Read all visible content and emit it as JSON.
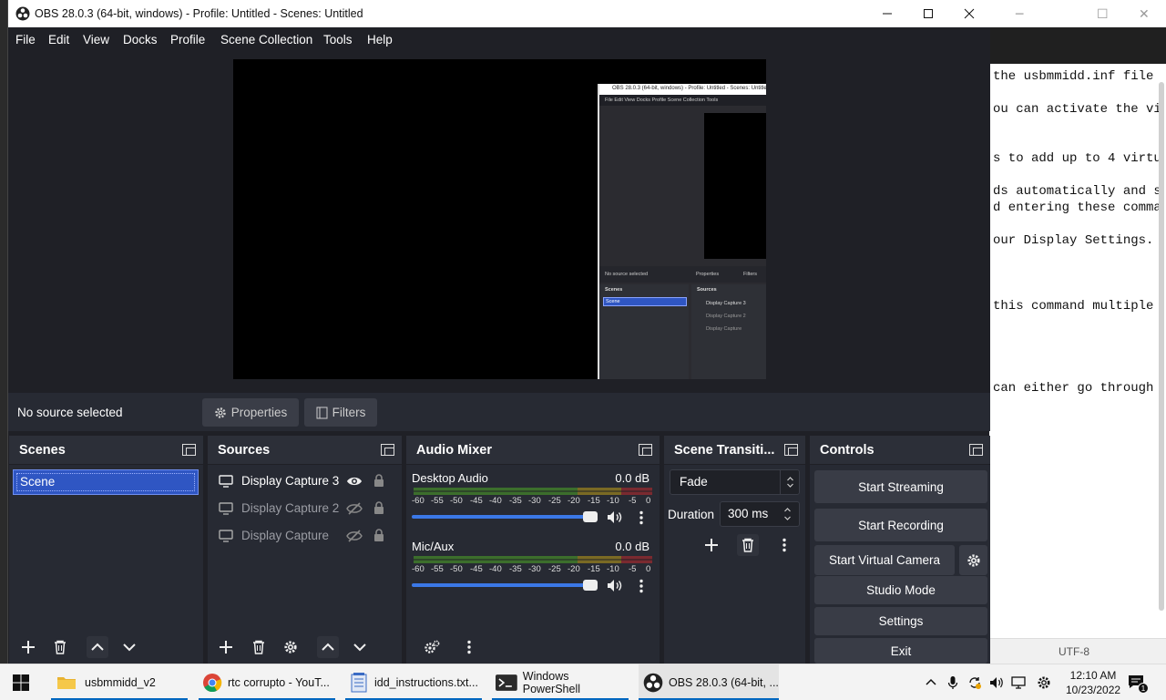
{
  "window": {
    "title": "OBS 28.0.3 (64-bit, windows) - Profile: Untitled - Scenes: Untitled"
  },
  "menu": [
    "File",
    "Edit",
    "View",
    "Docks",
    "Profile",
    "Scene Collection",
    "Tools",
    "Help"
  ],
  "nested_preview": {
    "title": "OBS 28.0.3 (64-bit, windows) - Profile: Untitled - Scenes: Untitled",
    "menu": "File   Edit   View   Docks   Profile   Scene Collection   Tools",
    "no_source": "No source selected",
    "properties": "Properties",
    "filters": "Filters",
    "scenes": "Scenes",
    "sources": "Sources",
    "scene": "Scene",
    "src1": "Display Capture 3",
    "src2": "Display Capture 2",
    "src3": "Display Capture"
  },
  "source_toolbar": {
    "no_source": "No source selected",
    "properties": "Properties",
    "filters": "Filters"
  },
  "scenes_dock": {
    "title": "Scenes",
    "items": [
      "Scene"
    ]
  },
  "sources_dock": {
    "title": "Sources",
    "items": [
      {
        "name": "Display Capture 3",
        "visible": true
      },
      {
        "name": "Display Capture 2",
        "visible": false
      },
      {
        "name": "Display Capture",
        "visible": false
      }
    ]
  },
  "audio_dock": {
    "title": "Audio Mixer",
    "channels": [
      {
        "name": "Desktop Audio",
        "db": "0.0 dB"
      },
      {
        "name": "Mic/Aux",
        "db": "0.0 dB"
      }
    ],
    "scale": [
      "-60",
      "-55",
      "-50",
      "-45",
      "-40",
      "-35",
      "-30",
      "-25",
      "-20",
      "-15",
      "-10",
      "-5",
      "0"
    ]
  },
  "transitions_dock": {
    "title": "Scene Transiti...",
    "transition": "Fade",
    "duration_label": "Duration",
    "duration_value": "300 ms"
  },
  "controls_dock": {
    "title": "Controls",
    "start_streaming": "Start Streaming",
    "start_recording": "Start Recording",
    "start_virtual_camera": "Start Virtual Camera",
    "studio_mode": "Studio Mode",
    "settings": "Settings",
    "exit": "Exit"
  },
  "notepad": {
    "lines": [
      " the usbmmidd.inf file",
      "ou can activate the vi",
      "s to add up to 4 virtu",
      "ds automatically and s",
      "d entering these comma",
      "our Display Settings. ",
      " this command multiple",
      " can either go through"
    ],
    "encoding": "UTF-8"
  },
  "taskbar": {
    "items": [
      {
        "label": "usbmmidd_v2"
      },
      {
        "label": "rtc corrupto - YouT..."
      },
      {
        "label": "idd_instructions.txt..."
      },
      {
        "label": "Windows PowerShell"
      },
      {
        "label": "OBS 28.0.3 (64-bit, ..."
      }
    ],
    "time": "12:10 AM",
    "date": "10/23/2022",
    "notif_count": "1"
  },
  "colors": {
    "selection": "#2f56c3",
    "slider": "#3b78e7",
    "panel": "#272a33",
    "background": "#1f2026"
  }
}
